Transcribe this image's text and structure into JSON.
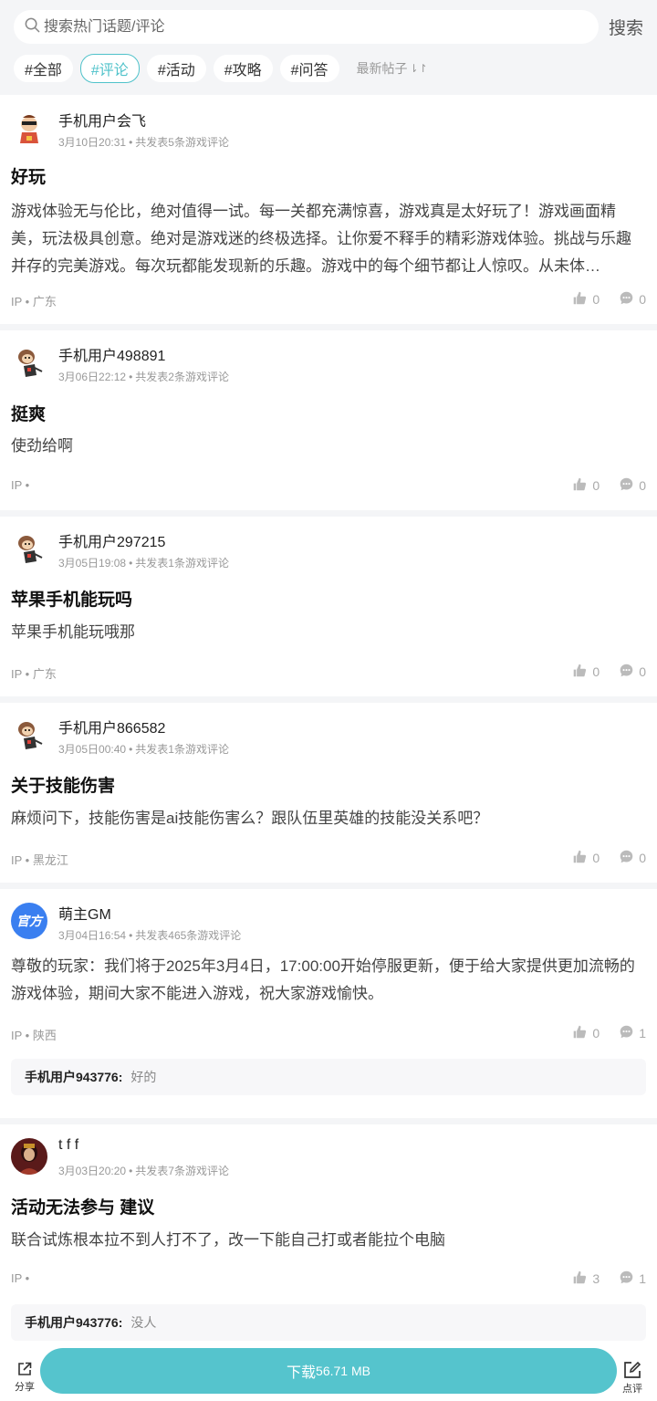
{
  "search": {
    "placeholder": "搜索热门话题/评论",
    "button": "搜索"
  },
  "tabs": [
    "#全部",
    "#评论",
    "#活动",
    "#攻略",
    "#问答"
  ],
  "active_tab": "#评论",
  "sort_label": "最新帖子",
  "sort_icon": "⇂↾",
  "accent_color": "#4fc2ca",
  "posts": [
    {
      "username": "手机用户会飞",
      "time": "3月10日20:31",
      "count": "共发表5条游戏评论",
      "title": "好玩",
      "body": "游戏体验无与伦比，绝对值得一试。每一关都充满惊喜，游戏真是太好玩了！游戏画面精美，玩法极具创意。绝对是游戏迷的终极选择。让你爱不释手的精彩游戏体验。挑战与乐趣并存的完美游戏。每次玩都能发现新的乐趣。游戏中的每个细节都让人惊叹。从未体…",
      "ip": "IP • 广东",
      "likes": "0",
      "comments": "0",
      "avatar": "cartoon-sunglasses"
    },
    {
      "username": "手机用户498891",
      "time": "3月06日22:12",
      "count": "共发表2条游戏评论",
      "title": "挺爽",
      "body": "使劲给啊",
      "ip": "IP •",
      "likes": "0",
      "comments": "0",
      "avatar": "cartoon-monkey"
    },
    {
      "username": "手机用户297215",
      "time": "3月05日19:08",
      "count": "共发表1条游戏评论",
      "title": "苹果手机能玩吗",
      "body": "苹果手机能玩哦那",
      "ip": "IP • 广东",
      "likes": "0",
      "comments": "0",
      "avatar": "cartoon-monkey"
    },
    {
      "username": "手机用户866582",
      "time": "3月05日00:40",
      "count": "共发表1条游戏评论",
      "title": "关于技能伤害",
      "body": "麻烦问下，技能伤害是ai技能伤害么？跟队伍里英雄的技能没关系吧？",
      "ip": "IP • 黑龙江",
      "likes": "0",
      "comments": "0",
      "avatar": "cartoon-monkey"
    },
    {
      "username": "萌主GM",
      "time": "3月04日16:54",
      "count": "共发表465条游戏评论",
      "title": "",
      "body": "尊敬的玩家：我们将于2025年3月4日，17:00:00开始停服更新，便于给大家提供更加流畅的游戏体验，期间大家不能进入游戏，祝大家游戏愉快。",
      "ip": "IP • 陕西",
      "likes": "0",
      "comments": "1",
      "avatar": "official-badge",
      "avatar_text": "官方",
      "reply_user": "手机用户943776:",
      "reply_text": "好的"
    },
    {
      "username": "t f f",
      "time": "3月03日20:20",
      "count": "共发表7条游戏评论",
      "title": "活动无法参与 建议",
      "body": "联合试炼根本拉不到人打不了，改一下能自己打或者能拉个电脑",
      "ip": "IP •",
      "likes": "3",
      "comments": "1",
      "avatar": "dark-character",
      "reply_user": "手机用户943776:",
      "reply_text": "没人"
    }
  ],
  "bottom": {
    "share_label": "分享",
    "download_prefix": "下载",
    "download_size": "56.71 MB",
    "review_label": "点评"
  }
}
